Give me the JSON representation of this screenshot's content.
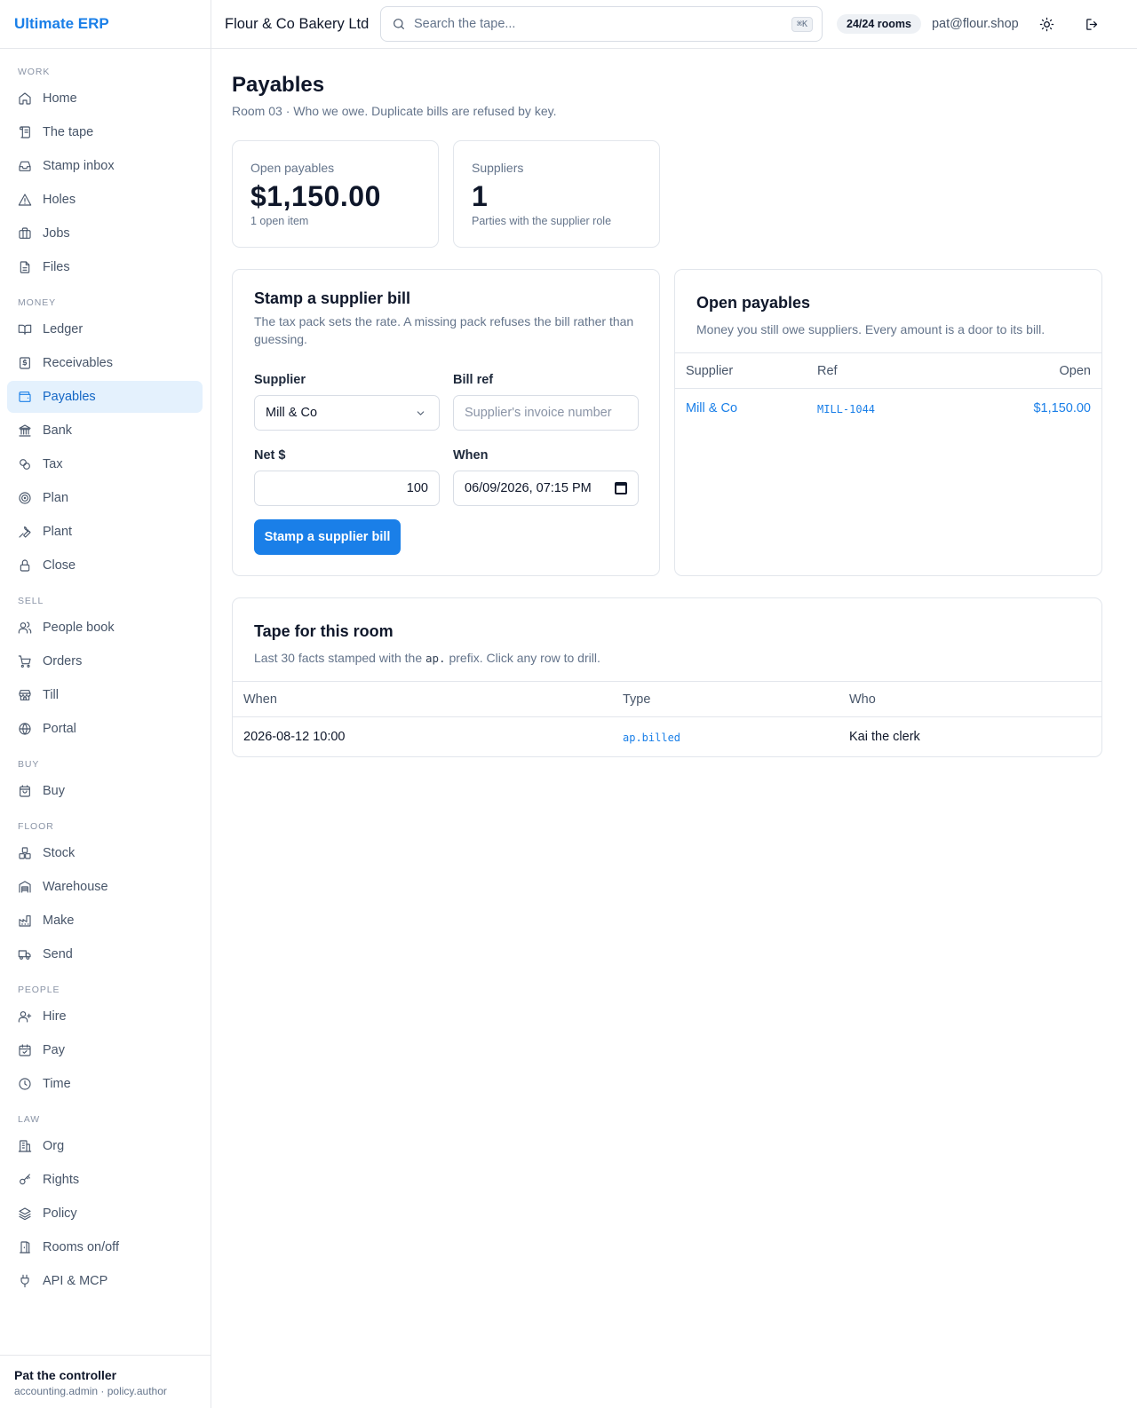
{
  "app": {
    "brand": "Ultimate ERP"
  },
  "topbar": {
    "org": "Flour & Co Bakery Ltd",
    "search_placeholder": "Search the tape...",
    "search_shortcut": "⌘K",
    "rooms_badge": "24/24 rooms",
    "email": "pat@flour.shop",
    "theme_icon": "sun-icon",
    "logout_icon": "logout-icon"
  },
  "sidebar": {
    "sections": [
      {
        "label": "WORK",
        "items": [
          {
            "label": "Home",
            "icon": "home-icon"
          },
          {
            "label": "The tape",
            "icon": "scroll-icon"
          },
          {
            "label": "Stamp inbox",
            "icon": "inbox-icon"
          },
          {
            "label": "Holes",
            "icon": "warning-icon"
          },
          {
            "label": "Jobs",
            "icon": "briefcase-icon"
          },
          {
            "label": "Files",
            "icon": "file-icon"
          }
        ]
      },
      {
        "label": "MONEY",
        "items": [
          {
            "label": "Ledger",
            "icon": "book-icon"
          },
          {
            "label": "Receivables",
            "icon": "receipt-icon"
          },
          {
            "label": "Payables",
            "icon": "wallet-icon",
            "active": true
          },
          {
            "label": "Bank",
            "icon": "bank-icon"
          },
          {
            "label": "Tax",
            "icon": "percent-icon"
          },
          {
            "label": "Plan",
            "icon": "target-icon"
          },
          {
            "label": "Plant",
            "icon": "wrench-icon"
          },
          {
            "label": "Close",
            "icon": "lock-icon"
          }
        ]
      },
      {
        "label": "SELL",
        "items": [
          {
            "label": "People book",
            "icon": "users-icon"
          },
          {
            "label": "Orders",
            "icon": "cart-icon"
          },
          {
            "label": "Till",
            "icon": "store-icon"
          },
          {
            "label": "Portal",
            "icon": "globe-icon"
          }
        ]
      },
      {
        "label": "BUY",
        "items": [
          {
            "label": "Buy",
            "icon": "bag-icon"
          }
        ]
      },
      {
        "label": "FLOOR",
        "items": [
          {
            "label": "Stock",
            "icon": "boxes-icon"
          },
          {
            "label": "Warehouse",
            "icon": "warehouse-icon"
          },
          {
            "label": "Make",
            "icon": "factory-icon"
          },
          {
            "label": "Send",
            "icon": "truck-icon"
          }
        ]
      },
      {
        "label": "PEOPLE",
        "items": [
          {
            "label": "Hire",
            "icon": "user-plus-icon"
          },
          {
            "label": "Pay",
            "icon": "calendar-check-icon"
          },
          {
            "label": "Time",
            "icon": "clock-icon"
          }
        ]
      },
      {
        "label": "LAW",
        "items": [
          {
            "label": "Org",
            "icon": "building-icon"
          },
          {
            "label": "Rights",
            "icon": "key-icon"
          },
          {
            "label": "Policy",
            "icon": "layers-icon"
          },
          {
            "label": "Rooms on/off",
            "icon": "door-icon"
          },
          {
            "label": "API & MCP",
            "icon": "plug-icon"
          }
        ]
      }
    ],
    "user": {
      "name": "Pat the controller",
      "roles": "accounting.admin · policy.author"
    }
  },
  "page": {
    "title": "Payables",
    "subtitle": "Room 03 · Who we owe. Duplicate bills are refused by key."
  },
  "stats": [
    {
      "label": "Open payables",
      "value": "$1,150.00",
      "note": "1 open item"
    },
    {
      "label": "Suppliers",
      "value": "1",
      "note": "Parties with the supplier role"
    }
  ],
  "bill_form": {
    "title": "Stamp a supplier bill",
    "description": "The tax pack sets the rate. A missing pack refuses the bill rather than guessing.",
    "supplier_label": "Supplier",
    "supplier_value": "Mill & Co",
    "ref_label": "Bill ref",
    "ref_placeholder": "Supplier's invoice number",
    "net_label": "Net $",
    "net_value": "100",
    "when_label": "When",
    "when_value": "06/09/2026, 07:15 PM",
    "submit_label": "Stamp a supplier bill"
  },
  "open_payables": {
    "title": "Open payables",
    "description": "Money you still owe suppliers. Every amount is a door to its bill.",
    "columns": [
      "Supplier",
      "Ref",
      "Open"
    ],
    "rows": [
      {
        "supplier": "Mill & Co",
        "ref": "MILL-1044",
        "open": "$1,150.00"
      }
    ]
  },
  "tape": {
    "title": "Tape for this room",
    "description_before": "Last 30 facts stamped with the ",
    "prefix": "ap.",
    "description_after": " prefix. Click any row to drill.",
    "columns": [
      "When",
      "Type",
      "Who"
    ],
    "rows": [
      {
        "when": "2026-08-12 10:00",
        "type": "ap.billed",
        "who": "Kai the clerk"
      }
    ]
  }
}
